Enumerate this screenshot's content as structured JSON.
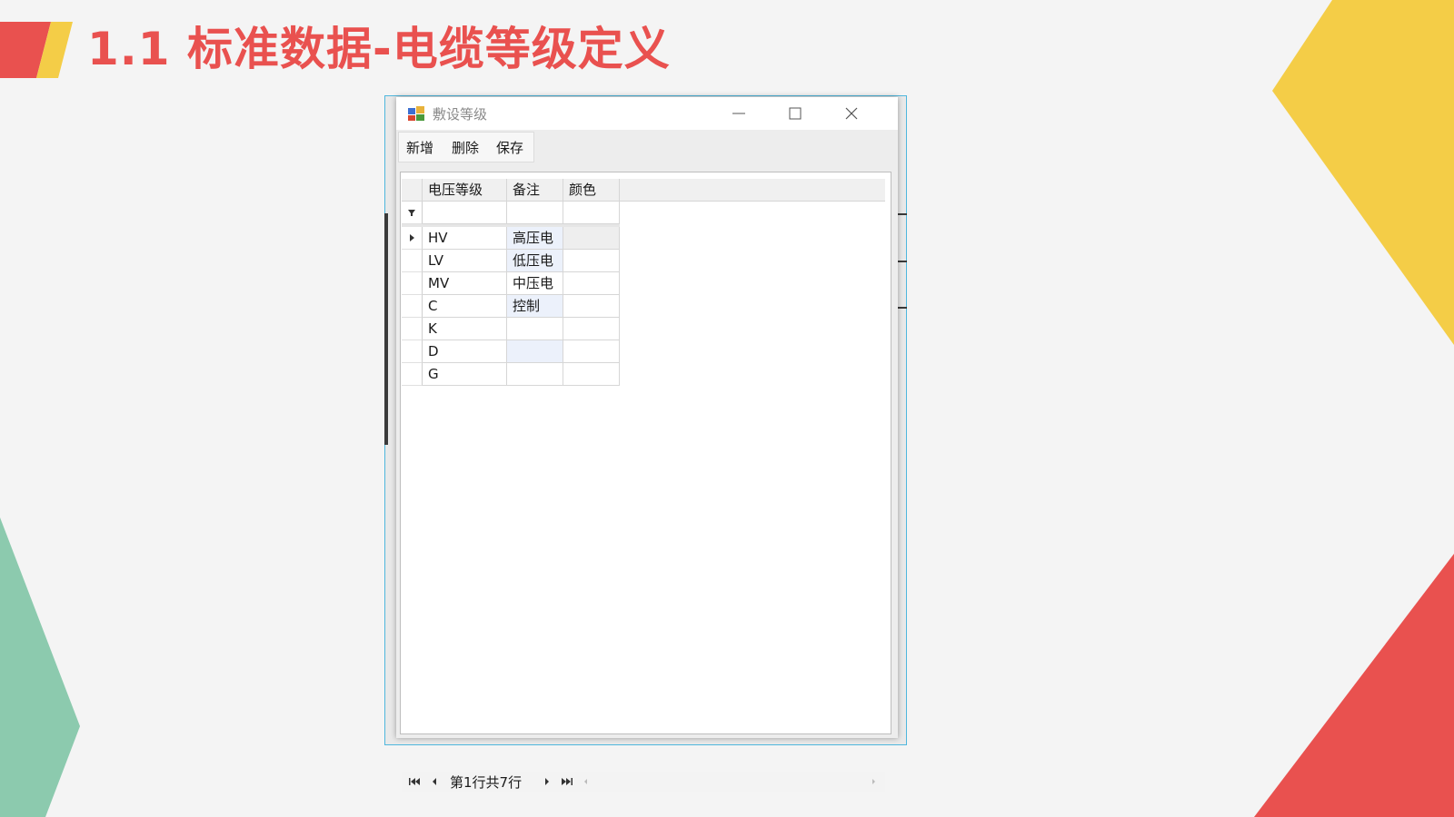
{
  "slide": {
    "title": "1.1 标准数据-电缆等级定义"
  },
  "dialog": {
    "title": "敷设等级",
    "toolbar": {
      "add_label": "新增",
      "delete_label": "删除",
      "save_label": "保存"
    },
    "grid": {
      "columns": [
        "电压等级",
        "备注",
        "颜色"
      ],
      "rows": [
        {
          "level": "HV",
          "note": "高压电",
          "color": ""
        },
        {
          "level": "LV",
          "note": "低压电",
          "color": ""
        },
        {
          "level": "MV",
          "note": "中压电",
          "color": ""
        },
        {
          "level": "C",
          "note": "控制",
          "color": ""
        },
        {
          "level": "K",
          "note": "",
          "color": ""
        },
        {
          "level": "D",
          "note": "",
          "color": ""
        },
        {
          "level": "G",
          "note": "",
          "color": ""
        }
      ]
    },
    "navigator": {
      "record_text": "第1行共7行"
    }
  },
  "colors": {
    "accent_red": "#e9514f",
    "accent_yellow": "#f4cd47",
    "accent_green": "#8ccaae",
    "window_border": "#4fb7dd"
  }
}
